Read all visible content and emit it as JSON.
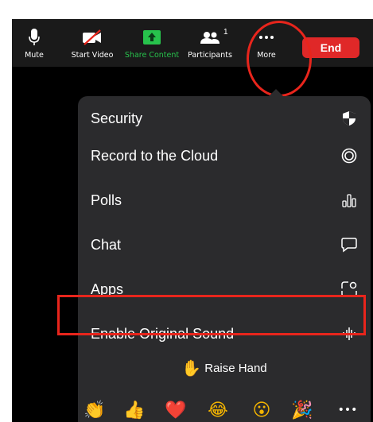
{
  "toolbar": {
    "mute_label": "Mute",
    "start_video_label": "Start Video",
    "share_content_label": "Share Content",
    "participants_label": "Participants",
    "participant_count": "1",
    "more_label": "More",
    "end_label": "End"
  },
  "menu": {
    "items": [
      {
        "label": "Security",
        "icon": "shield-icon"
      },
      {
        "label": "Record to the Cloud",
        "icon": "record-icon"
      },
      {
        "label": "Polls",
        "icon": "poll-icon"
      },
      {
        "label": "Chat",
        "icon": "chat-icon"
      },
      {
        "label": "Apps",
        "icon": "apps-icon"
      },
      {
        "label": "Enable Original Sound",
        "icon": "sound-wave-icon"
      }
    ],
    "raise_hand_label": "Raise Hand",
    "reactions": [
      "👏",
      "👍",
      "❤️",
      "😂",
      "😮",
      "🎉",
      "•••"
    ]
  },
  "colors": {
    "accent_red": "#e8251c",
    "end_red": "#e02828",
    "share_green": "#27c24c",
    "menu_bg": "#2b2b2d"
  }
}
